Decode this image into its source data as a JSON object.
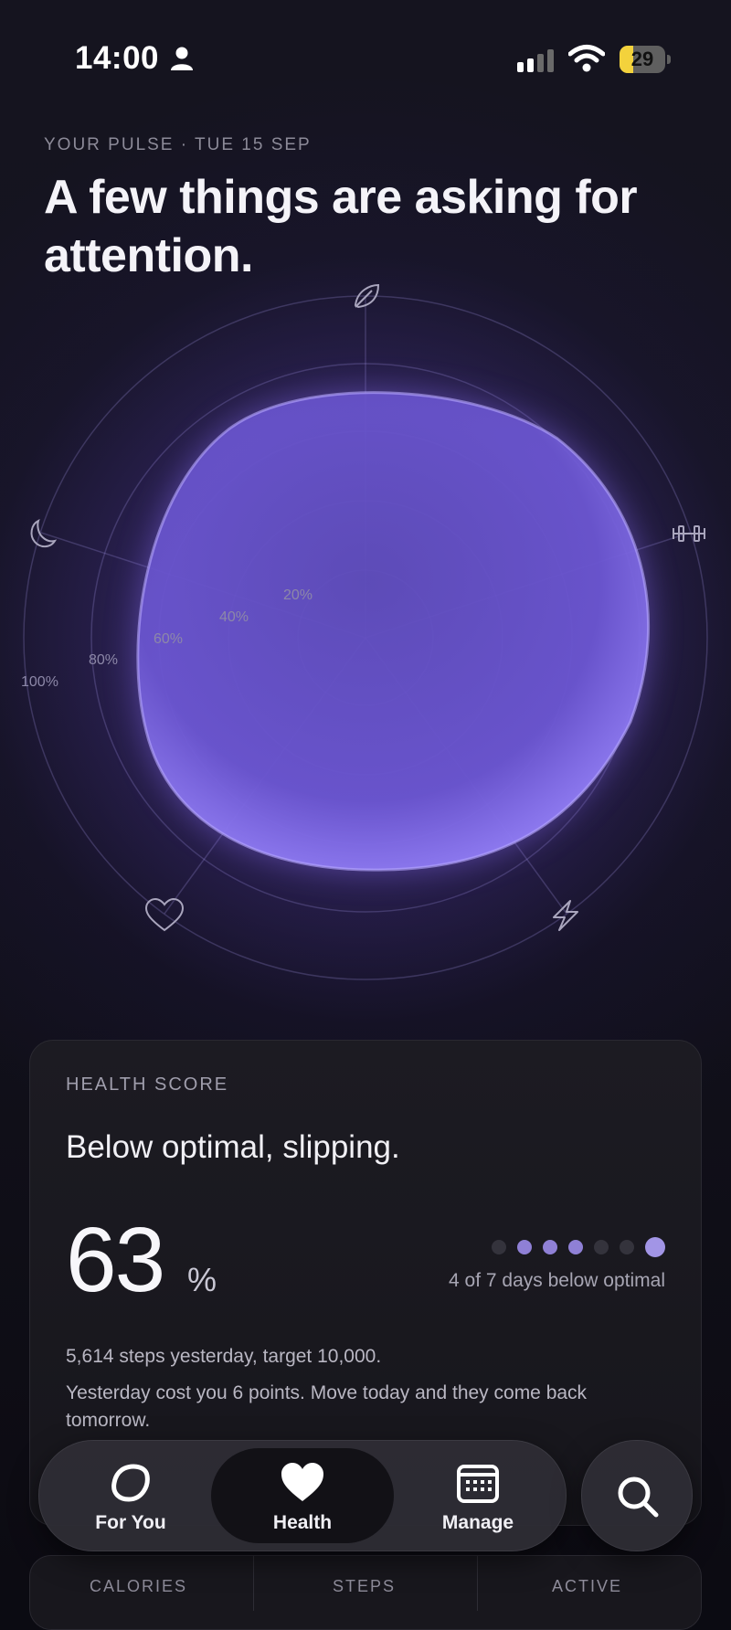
{
  "status_bar": {
    "time": "14:00",
    "battery": "29",
    "battery_level": 0.29
  },
  "header": {
    "eyebrow": "YOUR PULSE · TUE 15 SEP",
    "headline": "A few things are asking for attention."
  },
  "radar": {
    "ring_labels": [
      "20%",
      "40%",
      "60%",
      "80%",
      "100%"
    ],
    "axes": [
      "leaf-icon",
      "dumbbell-icon",
      "bolt-icon",
      "heart-icon",
      "moon-icon"
    ],
    "accent": "#7b62e0"
  },
  "health_card": {
    "label": "HEALTH SCORE",
    "title": "Below optimal, slipping.",
    "score": "63",
    "unit": "%",
    "days": [
      false,
      true,
      true,
      true,
      false,
      false,
      true
    ],
    "days_text": "4 of 7 days below optimal",
    "note1": "5,614 steps yesterday, target 10,000.",
    "note2": "Yesterday cost you 6 points. Move today and they come back tomorrow."
  },
  "next_card": {
    "labels": [
      "CALORIES",
      "STEPS",
      "ACTIVE"
    ]
  },
  "tabs": [
    {
      "label": "For You",
      "icon": "blob-icon",
      "active": false
    },
    {
      "label": "Health",
      "icon": "heart-icon",
      "active": true
    },
    {
      "label": "Manage",
      "icon": "calendar-icon",
      "active": false
    }
  ],
  "search": {
    "icon": "search-icon"
  }
}
